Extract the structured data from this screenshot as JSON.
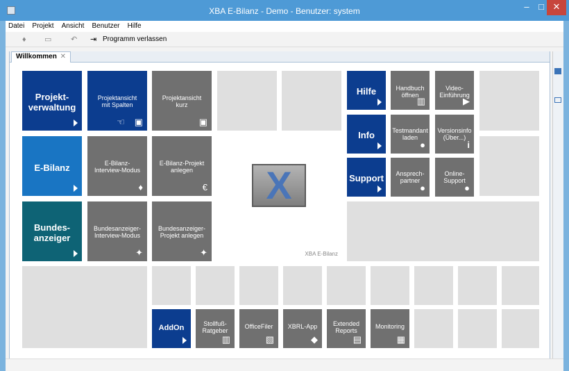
{
  "window": {
    "title": "XBA E-Bilanz - Demo - Benutzer: system",
    "minimize": "–",
    "maximize": "□",
    "close": "✕"
  },
  "menu": [
    "Datei",
    "Projekt",
    "Ansicht",
    "Benutzer",
    "Hilfe"
  ],
  "toolbar": {
    "exit_label": "Programm verlassen"
  },
  "tab": {
    "label": "Willkommen",
    "close": "✕"
  },
  "tiles": {
    "projektverwaltung": "Projekt-\nverwaltung",
    "projektansicht_spalten": "Projektansicht\nmit Spalten",
    "projektansicht_kurz": "Projektansicht\nkurz",
    "ebilanz": "E-Bilanz",
    "ebilanz_interview": "E-Bilanz-\nInterview-Modus",
    "ebilanz_projekt": "E-Bilanz-Projekt\nanlegen",
    "bundesanzeiger": "Bundes-\nanzeiger",
    "ba_interview": "Bundesanzeiger-\nInterview-Modus",
    "ba_projekt": "Bundesanzeiger-\nProjekt anlegen",
    "hilfe": "Hilfe",
    "handbuch": "Handbuch\nöffnen",
    "video": "Video-\nEinführung",
    "info": "Info",
    "testmandant": "Testmandant\nladen",
    "versionsinfo": "Versionsinfo\n(Über...)",
    "support": "Support",
    "ansprechpartner": "Ansprech-\npartner",
    "onlinesupport": "Online-\nSupport",
    "addon": "AddOn",
    "stollfuss": "Stollfuß-\nRatgeber",
    "officefiler": "OfficeFiler",
    "xbrlapp": "XBRL-App",
    "extended": "Extended\nReports",
    "monitoring": "Monitoring",
    "logo_caption": "XBA E-Bilanz"
  }
}
